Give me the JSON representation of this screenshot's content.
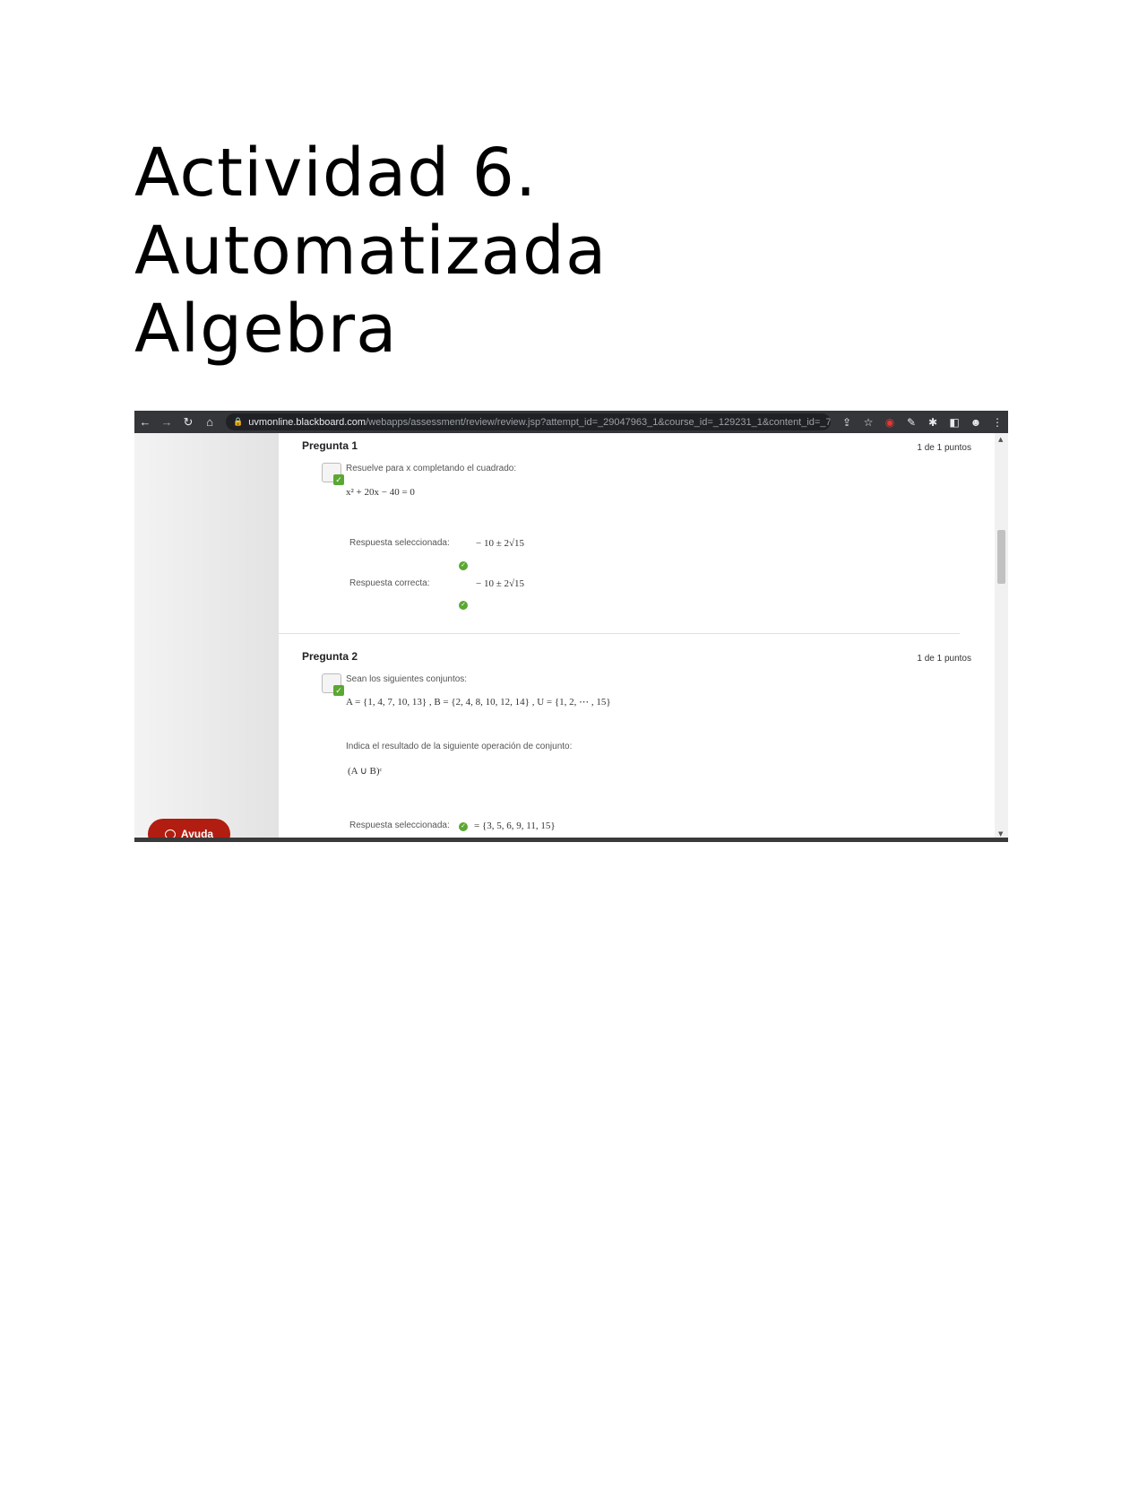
{
  "document": {
    "title_lines": [
      "Actividad 6.",
      "Automatizada",
      "Algebra"
    ]
  },
  "browser": {
    "url_host": "uvmonline.blackboard.com",
    "url_path": "/webapps/assessment/review/review.jsp?attempt_id=_29047963_1&course_id=_129231_1&content_id=_7..."
  },
  "help_button": {
    "label": "Ayuda"
  },
  "questions": [
    {
      "title": "Pregunta 1",
      "points": "1 de 1 puntos",
      "prompt": "Resuelve para x completando el cuadrado:",
      "equation": "x² + 20x − 40 = 0",
      "selected_label": "Respuesta seleccionada:",
      "selected_answer": "− 10 ± 2√15",
      "correct_label": "Respuesta correcta:",
      "correct_answer": "− 10 ± 2√15"
    },
    {
      "title": "Pregunta 2",
      "points": "1 de 1 puntos",
      "prompt": "Sean los siguientes conjuntos:",
      "sets": "A = {1, 4, 7, 10, 13} ,  B = {2, 4, 8, 10, 12, 14} ,  U = {1, 2,  ⋯ , 15}",
      "instruction": "Indica el resultado de la siguiente operación de conjunto:",
      "operation": "(A ∪ B)ᶜ",
      "selected_label": "Respuesta seleccionada:",
      "selected_answer": "= {3, 5, 6, 9, 11, 15}"
    }
  ]
}
